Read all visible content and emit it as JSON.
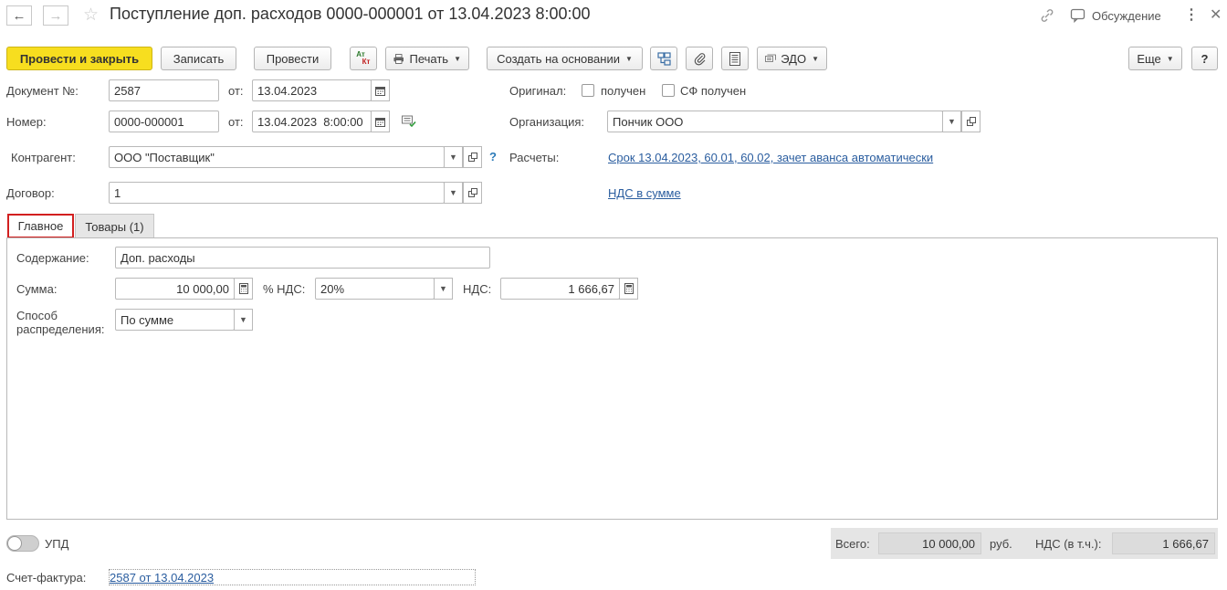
{
  "window": {
    "title": "Поступление доп. расходов 0000-000001 от 13.04.2023 8:00:00",
    "discussion_label": "Обсуждение"
  },
  "toolbar": {
    "post_close": "Провести и закрыть",
    "save": "Записать",
    "post": "Провести",
    "dt_kt_top": "Ат",
    "dt_kt_bottom": "Кт",
    "print": "Печать",
    "create_based": "Создать на основании",
    "edo": "ЭДО",
    "more": "Еще",
    "help": "?"
  },
  "header": {
    "doc_no_label": "Документ №:",
    "doc_no_value": "2587",
    "from_label": "от:",
    "doc_date": "13.04.2023",
    "number_label": "Номер:",
    "number_value": "0000-000001",
    "number_datetime": "13.04.2023  8:00:00",
    "original_label": "Оригинал:",
    "received_label": "получен",
    "sf_received_label": "СФ получен",
    "org_label": "Организация:",
    "org_value": "Пончик ООО",
    "counterparty_label": "Контрагент:",
    "counterparty_value": "ООО \"Поставщик\"",
    "counterparty_help": "?",
    "settlements_label": "Расчеты:",
    "settlements_link": "Срок 13.04.2023, 60.01, 60.02, зачет аванса автоматически",
    "contract_label": "Договор:",
    "contract_value": "1",
    "vat_link": "НДС в сумме"
  },
  "tabs": [
    {
      "label": "Главное",
      "active": true
    },
    {
      "label": "Товары (1)",
      "active": false
    }
  ],
  "main": {
    "content_label": "Содержание:",
    "content_value": "Доп. расходы",
    "sum_label": "Сумма:",
    "sum_value": "10 000,00",
    "vat_rate_label": "% НДС:",
    "vat_rate_value": "20%",
    "vat_label": "НДС:",
    "vat_value": "1 666,67",
    "dist_label_1": "Способ",
    "dist_label_2": "распределения:",
    "dist_value": "По сумме"
  },
  "footer": {
    "upd_label": "УПД",
    "total_label": "Всего:",
    "total_value": "10 000,00",
    "currency": "руб.",
    "vat_incl_label": "НДС (в т.ч.):",
    "vat_incl_value": "1 666,67",
    "invoice_label": "Счет-фактура:",
    "invoice_link": "2587 от 13.04.2023"
  },
  "colors": {
    "primary_button": "#f7de1f",
    "link": "#2a5d9f",
    "active_tab_border": "#d21f1f"
  }
}
